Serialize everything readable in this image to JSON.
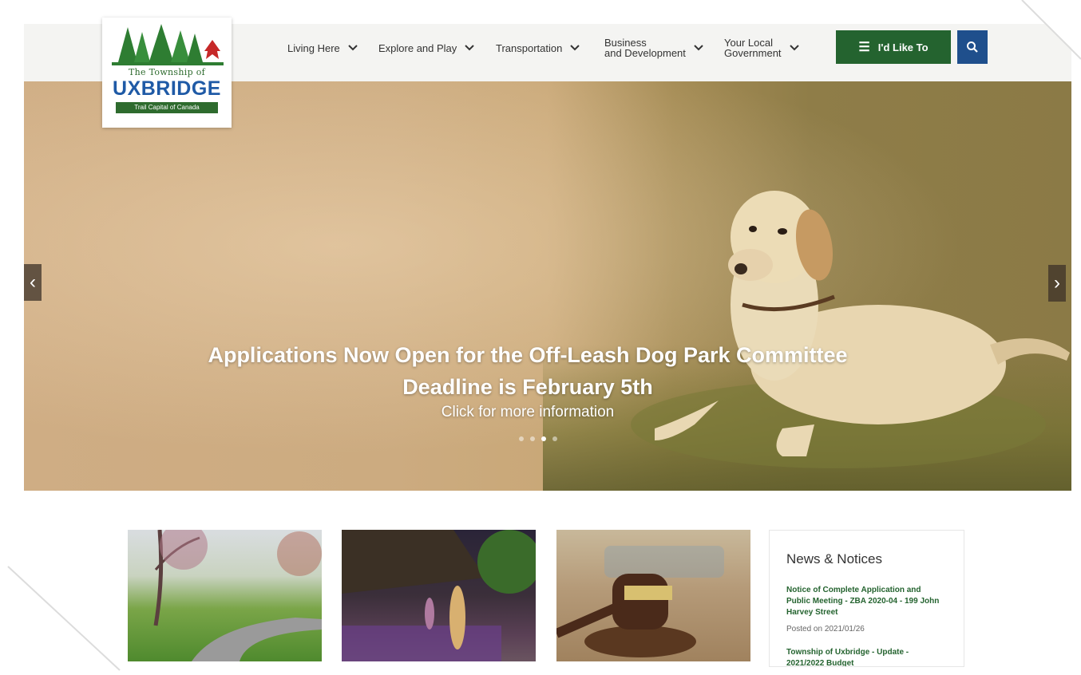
{
  "logo": {
    "tagline_top": "The Township of",
    "brand": "UXBRIDGE",
    "tagline_bottom": "Trail Capital of Canada"
  },
  "nav": {
    "items": [
      {
        "label": "Living Here"
      },
      {
        "label": "Explore and Play"
      },
      {
        "label": "Transportation"
      },
      {
        "label": "Business\nand Development"
      },
      {
        "label": "Your Local\nGovernment"
      }
    ],
    "cta_label": "I'd Like To",
    "cta_icon": "list-icon",
    "search_icon": "search-icon"
  },
  "hero": {
    "title_line1": "Applications Now Open for the Off-Leash Dog Park Committee",
    "title_line2": "Deadline is February 5th",
    "subtitle": "Click for more information",
    "slides": 4,
    "active_slide": 3,
    "prev_icon": "chevron-left-icon",
    "next_icon": "chevron-right-icon"
  },
  "news": {
    "heading": "News & Notices",
    "items": [
      {
        "title": "Notice of Complete Application and Public Meeting - ZBA 2020-04 - 199 John Harvey Street",
        "date": "Posted on 2021/01/26"
      },
      {
        "title": "Township of Uxbridge - Update - 2021/2022 Budget"
      }
    ]
  },
  "colors": {
    "brand_green": "#24632f",
    "brand_blue": "#1f4f8c"
  }
}
